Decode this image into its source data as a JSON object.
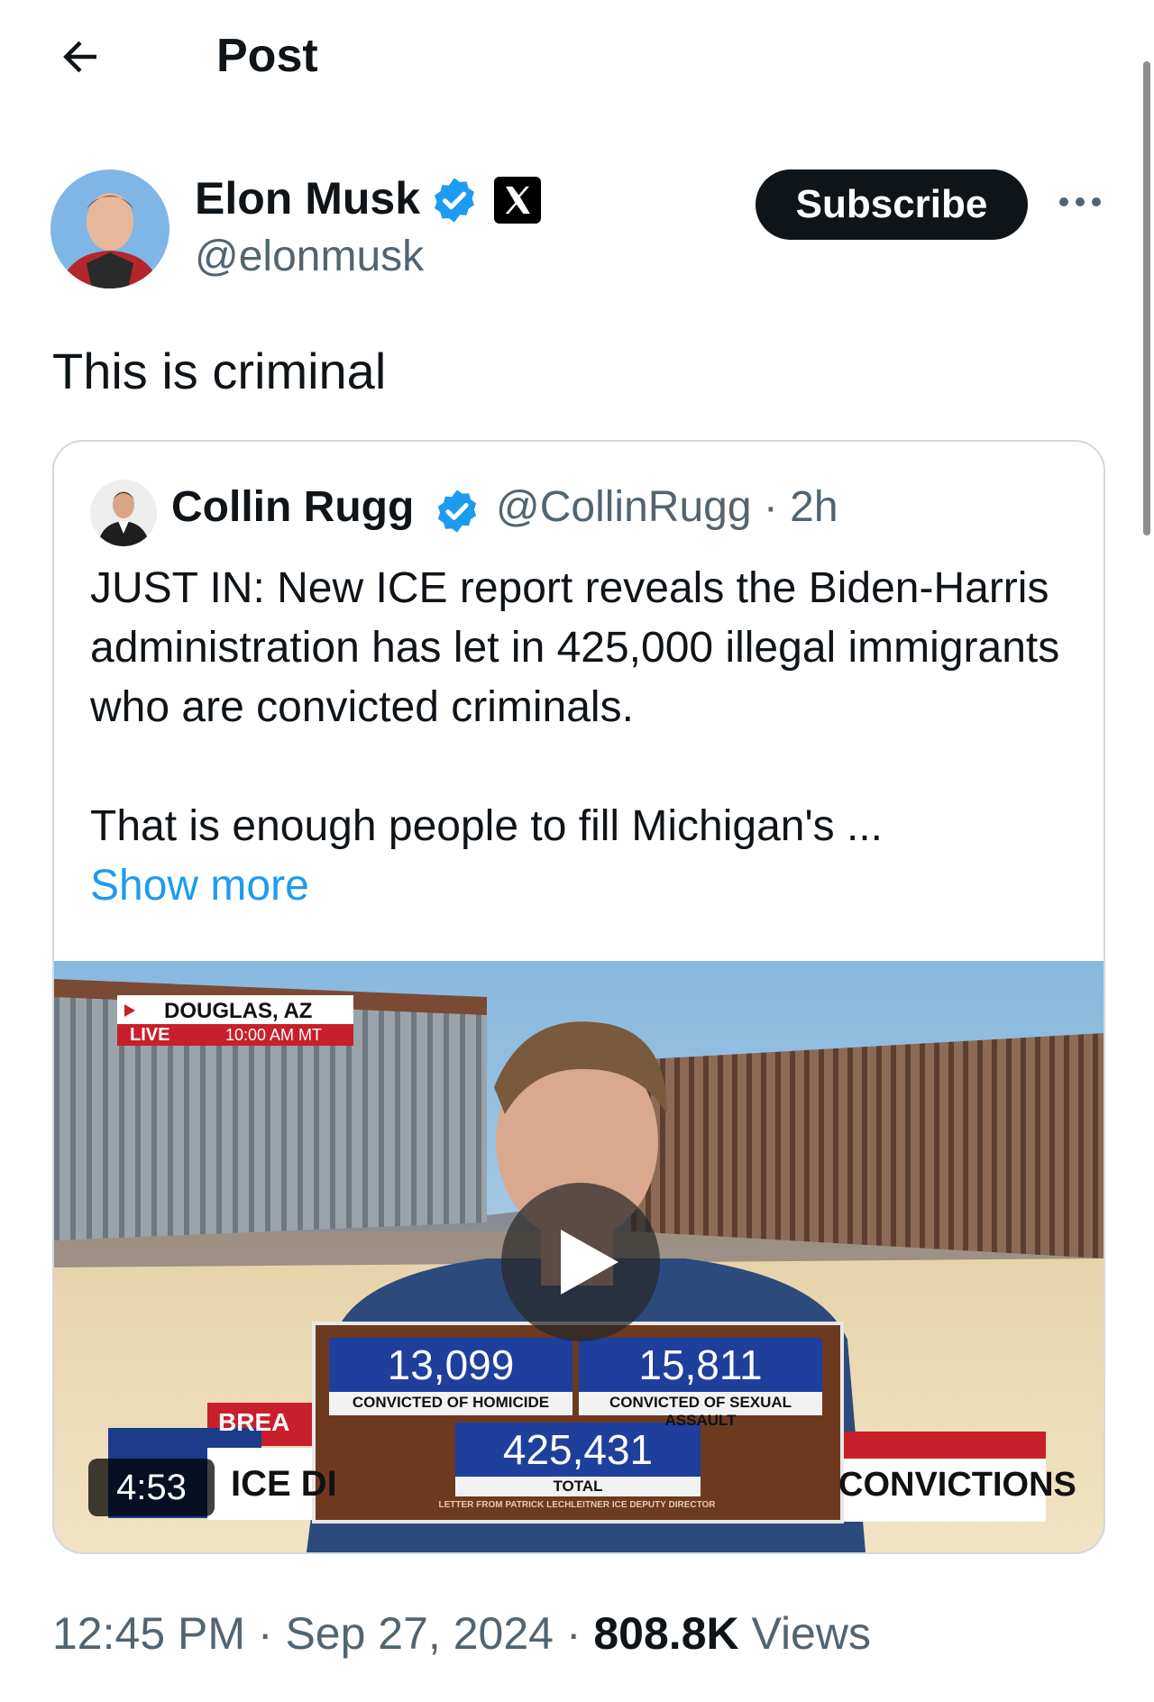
{
  "header": {
    "title": "Post"
  },
  "author": {
    "name": "Elon Musk",
    "handle": "@elonmusk"
  },
  "actions": {
    "subscribe_label": "Subscribe"
  },
  "tweet": {
    "text": "This is criminal"
  },
  "quote": {
    "name": "Collin Rugg",
    "handle_time": "@CollinRugg · 2h",
    "text_line1": "JUST IN: New ICE report reveals the Biden-Harris administration has let in 425,000 illegal immigrants who are convicted criminals.",
    "text_line2": "That is enough people to fill Michigan's ...",
    "show_more": "Show more"
  },
  "video": {
    "location": "DOUGLAS, AZ",
    "live": "LIVE",
    "time": "10:00 AM MT",
    "stat1_value": "13,099",
    "stat1_label": "CONVICTED OF HOMICIDE",
    "stat2_value": "15,811",
    "stat2_label": "CONVICTED OF SEXUAL ASSAULT",
    "total_value": "425,431",
    "total_label": "TOTAL",
    "source_note": "LETTER FROM PATRICK LECHLEITNER ICE DEPUTY DIRECTOR",
    "breaking": "BREA",
    "ticker_left": "ICE DI",
    "ticker_right": "CONVICTIONS",
    "duration": "4:53"
  },
  "meta": {
    "timestamp": "12:45 PM · Sep 27, 2024 · ",
    "views_count": "808.8K",
    "views_label": " Views"
  },
  "colors": {
    "accent": "#1d9bf0",
    "text": "#0f1419",
    "muted": "#536471"
  }
}
